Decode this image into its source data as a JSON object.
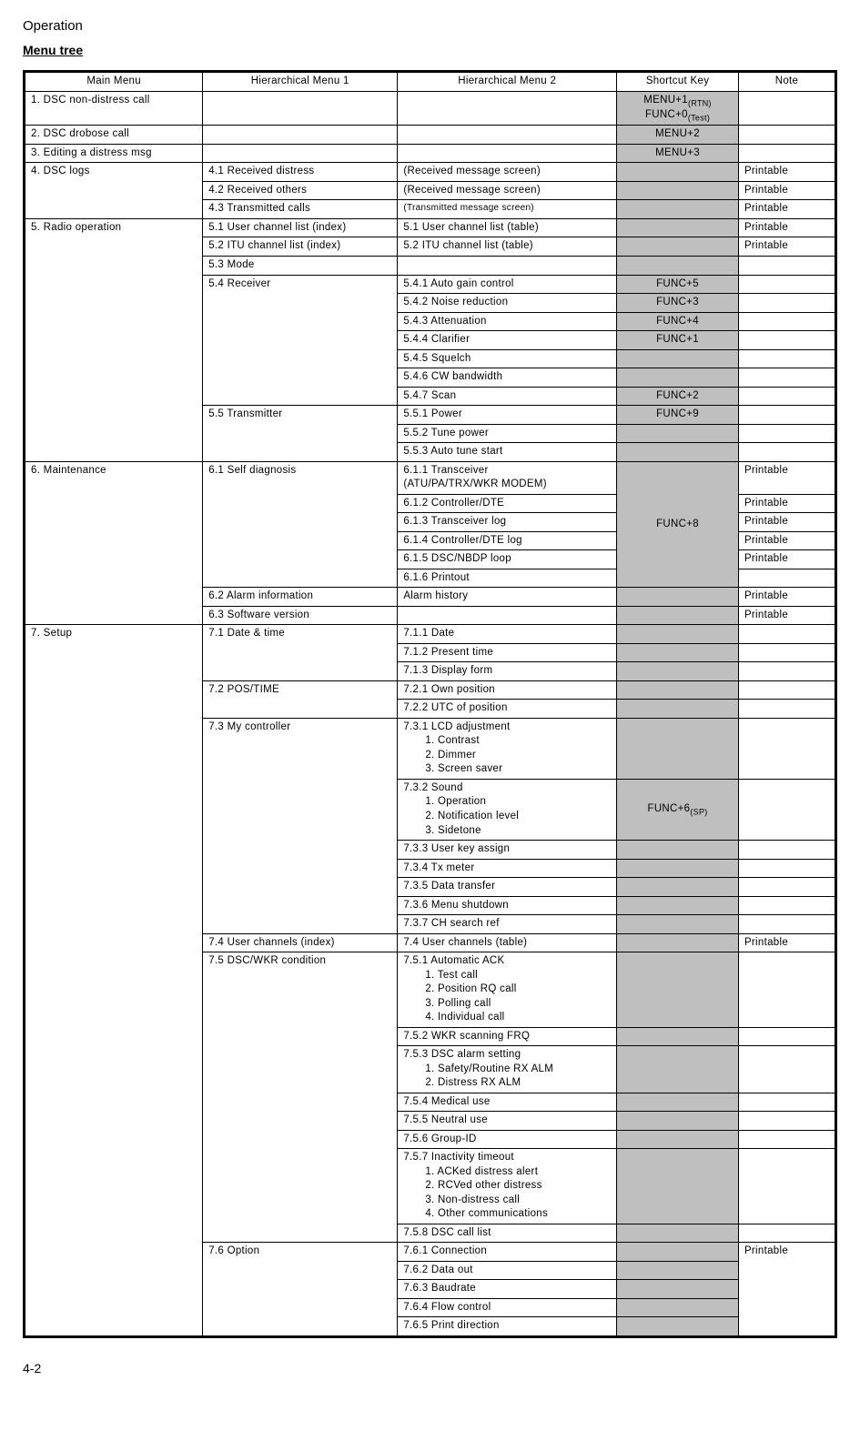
{
  "header": {
    "operation": "Operation",
    "menu_tree": "Menu tree"
  },
  "columns": {
    "c1": "Main Menu",
    "c2": "Hierarchical Menu 1",
    "c3": "Hierarchical Menu 2",
    "c4": "Shortcut Key",
    "c5": "Note"
  },
  "footer": {
    "page": "4-2"
  },
  "m1": {
    "label": "1. DSC non-distress call",
    "shortcut_a": "MENU+1",
    "shortcut_a_sub": "(RTN)",
    "shortcut_b": "FUNC+0",
    "shortcut_b_sub": "(Test)"
  },
  "m2": {
    "label": "2. DSC drobose call",
    "shortcut": "MENU+2"
  },
  "m3": {
    "label": "3. Editing a distress msg",
    "shortcut": "MENU+3"
  },
  "m4": {
    "label": "4. DSC logs",
    "r1": {
      "h1": "4.1 Received distress",
      "h2": "(Received message screen)",
      "note": "Printable"
    },
    "r2": {
      "h1": "4.2 Received others",
      "h2": "(Received message screen)",
      "note": "Printable"
    },
    "r3": {
      "h1": "4.3 Transmitted calls",
      "h2": "(Transmitted message screen)",
      "note": "Printable"
    }
  },
  "m5": {
    "label": "5. Radio operation",
    "r1": {
      "h1": "5.1 User channel list (index)",
      "h2": "5.1 User channel list (table)",
      "note": "Printable"
    },
    "r2": {
      "h1": "5.2 ITU channel list (index)",
      "h2": "5.2 ITU channel list (table)",
      "note": "Printable"
    },
    "r3": {
      "h1": "5.3 Mode"
    },
    "r4": {
      "h1": "5.4 Receiver",
      "s1": {
        "h2": "5.4.1 Auto gain control",
        "sc": "FUNC+5"
      },
      "s2": {
        "h2": "5.4.2 Noise reduction",
        "sc": "FUNC+3"
      },
      "s3": {
        "h2": "5.4.3 Attenuation",
        "sc": "FUNC+4"
      },
      "s4": {
        "h2": "5.4.4 Clarifier",
        "sc": "FUNC+1"
      },
      "s5": {
        "h2": "5.4.5 Squelch"
      },
      "s6": {
        "h2": "5.4.6 CW bandwidth"
      },
      "s7": {
        "h2": "5.4.7 Scan",
        "sc": "FUNC+2"
      }
    },
    "r5": {
      "h1": "5.5 Transmitter",
      "s1": {
        "h2": "5.5.1 Power",
        "sc": "FUNC+9"
      },
      "s2": {
        "h2": "5.5.2 Tune power"
      },
      "s3": {
        "h2": "5.5.3 Auto tune start"
      }
    }
  },
  "m6": {
    "label": "6. Maintenance",
    "r1": {
      "h1": "6.1 Self diagnosis",
      "sc": "FUNC+8",
      "s1": {
        "h2a": "6.1.1 Transceiver",
        "h2b": " (ATU/PA/TRX/WKR MODEM)",
        "note": "Printable"
      },
      "s2": {
        "h2": "6.1.2 Controller/DTE",
        "note": "Printable"
      },
      "s3": {
        "h2": "6.1.3 Transceiver log",
        "note": "Printable"
      },
      "s4": {
        "h2": "6.1.4 Controller/DTE log",
        "note": "Printable"
      },
      "s5": {
        "h2": "6.1.5 DSC/NBDP loop",
        "note": "Printable"
      },
      "s6": {
        "h2": "6.1.6 Printout"
      }
    },
    "r2": {
      "h1": "6.2 Alarm information",
      "h2": "Alarm history",
      "note": "Printable"
    },
    "r3": {
      "h1": "6.3 Software version",
      "note": "Printable"
    }
  },
  "m7": {
    "label": "7. Setup",
    "r1": {
      "h1": "7.1 Date & time",
      "s1": {
        "h2": "7.1.1 Date"
      },
      "s2": {
        "h2": "7.1.2 Present time"
      },
      "s3": {
        "h2": "7.1.3 Display form"
      }
    },
    "r2": {
      "h1": "7.2 POS/TIME",
      "s1": {
        "h2": "7.2.1 Own position"
      },
      "s2": {
        "h2": "7.2.2 UTC of position"
      }
    },
    "r3": {
      "h1": "7.3 My controller",
      "s1": {
        "h2": "7.3.1 LCD adjustment",
        "l1": "1.  Contrast",
        "l2": "2.  Dimmer",
        "l3": "3.  Screen saver"
      },
      "s2": {
        "h2": "7.3.2 Sound",
        "l1": "1.  Operation",
        "l2": "2.  Notification level",
        "l3": "3.  Sidetone",
        "sc": "FUNC+6",
        "sc_sub": "(SP)"
      },
      "s3": {
        "h2": "7.3.3 User key assign"
      },
      "s4": {
        "h2": "7.3.4 Tx meter"
      },
      "s5": {
        "h2": "7.3.5 Data transfer"
      },
      "s6": {
        "h2": "7.3.6 Menu shutdown"
      },
      "s7": {
        "h2": "7.3.7 CH search ref"
      }
    },
    "r4": {
      "h1": "7.4 User channels (index)",
      "h2": "7.4 User channels (table)",
      "note": "Printable"
    },
    "r5": {
      "h1": "7.5 DSC/WKR condition",
      "s1": {
        "h2": "7.5.1 Automatic ACK",
        "l1": "1.  Test call",
        "l2": "2.  Position RQ call",
        "l3": "3.  Polling call",
        "l4": "4.  Individual call"
      },
      "s2": {
        "h2": "7.5.2 WKR scanning FRQ"
      },
      "s3": {
        "h2": "7.5.3 DSC alarm setting",
        "l1": "1.  Safety/Routine RX ALM",
        "l2": "2.  Distress RX ALM"
      },
      "s4": {
        "h2": "7.5.4 Medical use"
      },
      "s5": {
        "h2": "7.5.5 Neutral use"
      },
      "s6": {
        "h2": "7.5.6 Group-ID"
      },
      "s7": {
        "h2": "7.5.7 Inactivity timeout",
        "l1": "1.  ACKed distress alert",
        "l2": "2.  RCVed other distress",
        "l3": "3.  Non-distress call",
        "l4": "4.  Other communications"
      },
      "s8": {
        "h2": "7.5.8 DSC call list"
      }
    },
    "r6": {
      "h1": "7.6 Option",
      "note": "Printable",
      "s1": {
        "h2": "7.6.1 Connection"
      },
      "s2": {
        "h2": "7.6.2 Data out"
      },
      "s3": {
        "h2": "7.6.3 Baudrate"
      },
      "s4": {
        "h2": "7.6.4 Flow control"
      },
      "s5": {
        "h2": "7.6.5 Print direction"
      }
    }
  }
}
